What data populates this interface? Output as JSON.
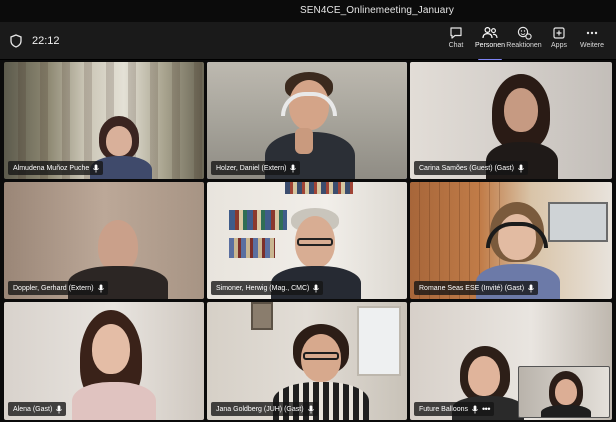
{
  "window": {
    "title": "SEN4CE_Onlinemeeting_January"
  },
  "toolbar": {
    "timer": "22:12",
    "buttons": [
      {
        "label": "Chat",
        "icon": "chat-icon"
      },
      {
        "label": "Personen",
        "icon": "people-icon",
        "active": true
      },
      {
        "label": "Reaktionen",
        "icon": "reactions-icon"
      },
      {
        "label": "Apps",
        "icon": "apps-icon"
      },
      {
        "label": "Weitere",
        "icon": "more-icon"
      }
    ]
  },
  "accent_color": "#7f85f5",
  "participants": [
    {
      "name": "Almudena Muñoz Puche"
    },
    {
      "name": "Holzer, Daniel (Extern)",
      "active": true
    },
    {
      "name": "Carina Samões (Guest) (Gast)"
    },
    {
      "name": "Doppler, Gerhard (Extern)"
    },
    {
      "name": "Simoner, Herwig (Mag., CMC)"
    },
    {
      "name": "Romane Seas ESE (Invité) (Gast)"
    },
    {
      "name": "Alena (Gast)"
    },
    {
      "name": "Jana Goldberg (JUH) (Gast)"
    },
    {
      "name": "Future Balloons"
    }
  ]
}
